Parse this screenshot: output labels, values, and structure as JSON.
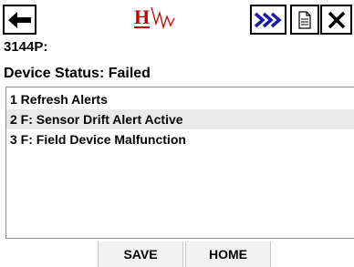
{
  "toolbar": {
    "back_icon": "arrow-left-icon",
    "logo_icon": "hart-logo-icon",
    "forward_icon": "double-chevron-right-icon",
    "document_icon": "document-icon",
    "close_icon": "close-x-icon",
    "forward_color": "#1a1aa8",
    "logo_color": "#cc0000"
  },
  "device": {
    "tag": "3144P:",
    "status": "Device Status: Failed"
  },
  "menu": {
    "items": [
      {
        "label": "1 Refresh Alerts",
        "selected": false
      },
      {
        "label": "2 F: Sensor Drift Alert Active",
        "selected": true
      },
      {
        "label": "3 F: Field Device Malfunction",
        "selected": false
      }
    ]
  },
  "buttons": {
    "save": "SAVE",
    "home": "HOME"
  }
}
